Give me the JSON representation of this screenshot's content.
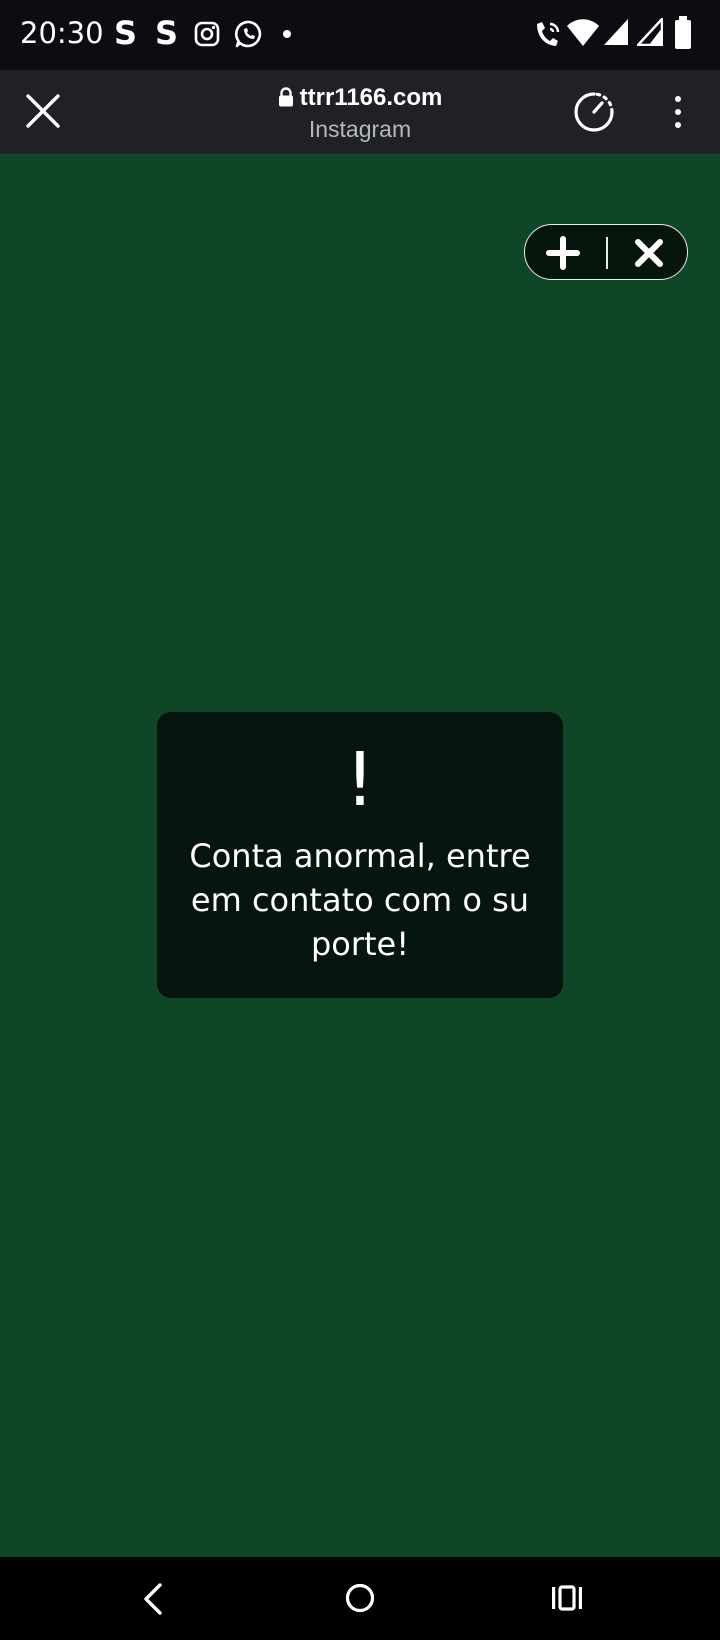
{
  "status_bar": {
    "time": "20:30",
    "notif_s1": "S",
    "notif_s2": "S",
    "icons": [
      "instagram-icon",
      "whatsapp-icon",
      "dot-icon",
      "wifi-calling-icon",
      "wifi-icon",
      "signal-icon",
      "signal-icon",
      "battery-icon"
    ]
  },
  "toolbar": {
    "url": "ttrr1166.com",
    "subtitle": "Instagram",
    "icons": [
      "close-icon",
      "lock-icon",
      "timer-icon",
      "more-vert-icon"
    ]
  },
  "overlay_controls": {
    "icons": [
      "plus-icon",
      "close-icon"
    ]
  },
  "dialog": {
    "mark": "!",
    "message": "Conta anormal, entre em contato com o su porte!"
  },
  "nav_bar": {
    "icons": [
      "back-icon",
      "home-icon",
      "recents-icon"
    ]
  },
  "colors": {
    "page_bg": "#0f4627",
    "dialog_bg": "#06150d",
    "toolbar_bg": "#202124",
    "status_bg": "#0b0d12"
  }
}
